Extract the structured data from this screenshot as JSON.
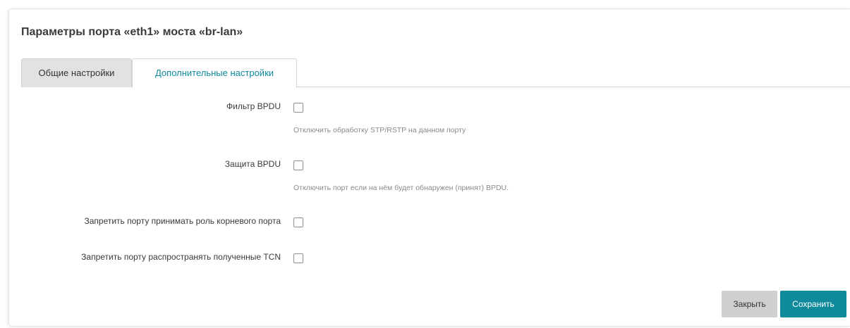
{
  "modal": {
    "title": "Параметры порта «eth1» моста «br-lan»"
  },
  "tabs": [
    {
      "label": "Общие настройки",
      "active": false
    },
    {
      "label": "Дополнительные настройки",
      "active": true
    }
  ],
  "fields": [
    {
      "label": "Фильтр BPDU",
      "checked": false,
      "description": "Отключить обработку STP/RSTP на данном порту"
    },
    {
      "label": "Защита BPDU",
      "checked": false,
      "description": "Отключить порт если на нём будет обнаружен (принят) BPDU."
    },
    {
      "label": "Запретить порту принимать роль корневого порта",
      "checked": false
    },
    {
      "label": "Запретить порту распространять полученные TCN",
      "checked": false
    }
  ],
  "buttons": {
    "close_label": "Закрыть",
    "save_label": "Сохранить"
  },
  "colors": {
    "accent": "#0f8a9b",
    "inactive_tab": "#e2e2e2",
    "close_button": "#cfcfcf"
  }
}
